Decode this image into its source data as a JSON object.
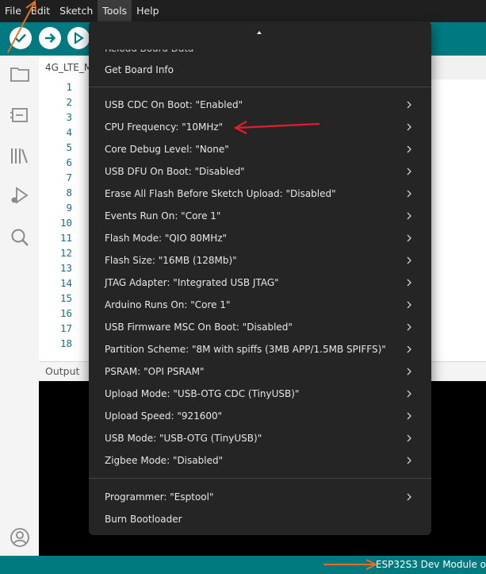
{
  "menubar": {
    "items": [
      "File",
      "Edit",
      "Sketch",
      "Tools",
      "Help"
    ],
    "active": "Tools"
  },
  "editor": {
    "tab_label": "4G_LTE_M",
    "line_numbers": [
      "1",
      "2",
      "3",
      "4",
      "5",
      "6",
      "7",
      "8",
      "9",
      "10",
      "11",
      "12",
      "13",
      "14",
      "15",
      "16",
      "17",
      "18"
    ]
  },
  "output": {
    "title": "Output"
  },
  "statusbar": {
    "board": "ESP32S3 Dev Module o"
  },
  "tools_menu": {
    "partial_top": "Reload Board Data",
    "get_board_info": "Get Board Info",
    "options": [
      "USB CDC On Boot: \"Enabled\"",
      "CPU Frequency: \"10MHz\"",
      "Core Debug Level: \"None\"",
      "USB DFU On Boot: \"Disabled\"",
      "Erase All Flash Before Sketch Upload: \"Disabled\"",
      "Events Run On: \"Core 1\"",
      "Flash Mode: \"QIO 80MHz\"",
      "Flash Size: \"16MB (128Mb)\"",
      "JTAG Adapter: \"Integrated USB JTAG\"",
      "Arduino Runs On: \"Core 1\"",
      "USB Firmware MSC On Boot: \"Disabled\"",
      "Partition Scheme: \"8M with spiffs (3MB APP/1.5MB SPIFFS)\"",
      "PSRAM: \"OPI PSRAM\"",
      "Upload Mode: \"USB-OTG CDC (TinyUSB)\"",
      "Upload Speed: \"921600\"",
      "USB Mode: \"USB-OTG (TinyUSB)\"",
      "Zigbee Mode: \"Disabled\""
    ],
    "programmer": "Programmer: \"Esptool\"",
    "burn_bootloader": "Burn Bootloader"
  },
  "colors": {
    "toolbar": "#007a80",
    "menu_bg": "#252526",
    "annotation_red": "#e0202e",
    "annotation_orange": "#e0712b"
  },
  "icons": [
    "verify-icon",
    "upload-icon",
    "debug-icon",
    "folder-icon",
    "board-icon",
    "library-icon",
    "debugger-icon",
    "search-icon",
    "account-icon",
    "chevron-right-icon",
    "scroll-up-icon"
  ]
}
